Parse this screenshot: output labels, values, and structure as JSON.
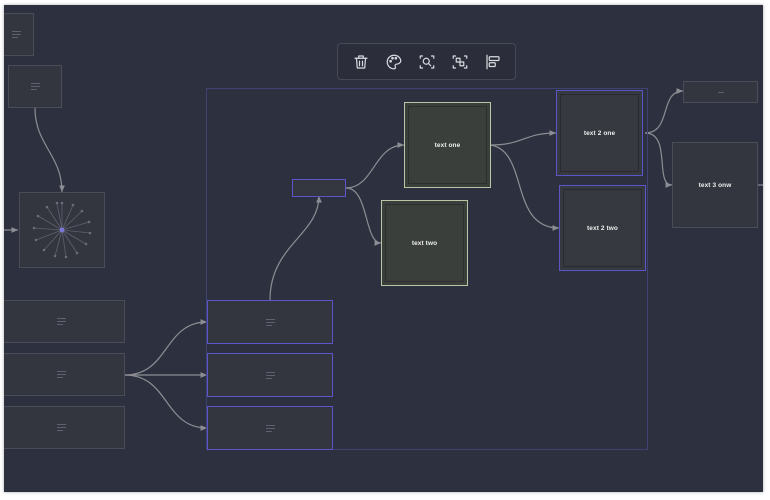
{
  "toolbar": {
    "buttons": [
      {
        "icon": "trash-icon",
        "name": "delete-button"
      },
      {
        "icon": "palette-icon",
        "name": "color-button"
      },
      {
        "icon": "zoom-search-icon",
        "name": "zoom-button"
      },
      {
        "icon": "fit-selection-icon",
        "name": "fit-button"
      },
      {
        "icon": "align-left-icon",
        "name": "align-button"
      }
    ]
  },
  "nodes": {
    "text_one": "text one",
    "text_two": "text two",
    "text_2_one": "text 2 one",
    "text_2_two": "text 2 two",
    "text_3_onw": "text 3 onw"
  },
  "colors": {
    "canvas_bg": "#2d313f",
    "node_bg": "#33363e",
    "node_border": "#4a4d57",
    "selection": "#5b55c8",
    "group_frame": "#3f4374",
    "green_border": "#b9c6a6",
    "edge": "#8c8e93"
  }
}
